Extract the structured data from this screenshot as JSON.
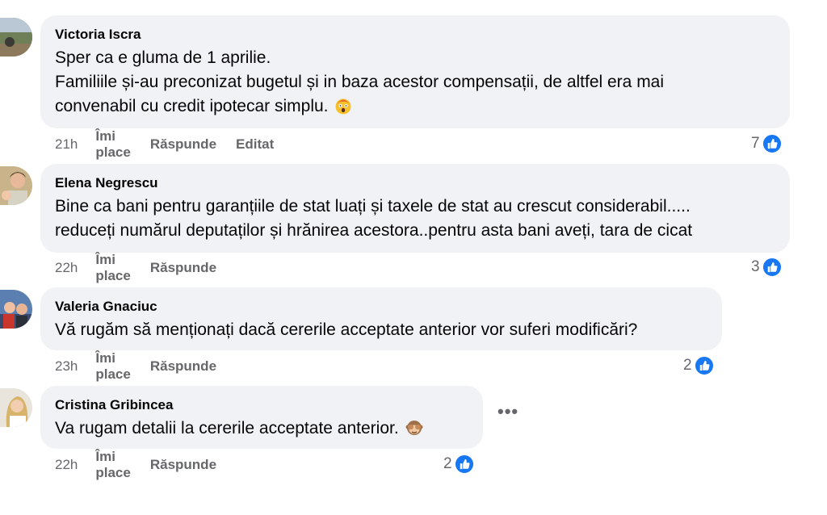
{
  "comments": [
    {
      "author": "Victoria Iscra",
      "lines": [
        "Sper ca e gluma de 1 aprilie.",
        "Familiile și-au preconizat bugetul și in baza acestor compensații, de altfel era mai",
        "convenabil cu credit ipotecar simplu."
      ],
      "emoji": "shocked-face-emoji",
      "time": "21h",
      "like_label": "Îmi place",
      "reply_label": "Răspunde",
      "edited_label": "Editat",
      "reactions_count": "7"
    },
    {
      "author": "Elena Negrescu",
      "lines": [
        "Bine ca bani pentru garanțiile de stat luați și taxele de stat au crescut considerabil.....",
        "reduceți numărul deputaților și hrănirea acestora..pentru asta bani aveți, tara de cicat"
      ],
      "time": "22h",
      "like_label": "Îmi place",
      "reply_label": "Răspunde",
      "reactions_count": "3"
    },
    {
      "author": "Valeria Gnaciuc",
      "lines": [
        "Vă rugăm să menționați dacă cererile acceptate anterior vor suferi modificări?"
      ],
      "time": "23h",
      "like_label": "Îmi place",
      "reply_label": "Răspunde",
      "reactions_count": "2"
    },
    {
      "author": "Cristina Gribincea",
      "lines": [
        "Va rugam detalii la cererile acceptate anterior."
      ],
      "emoji": "see-no-evil-monkey-emoji",
      "time": "22h",
      "like_label": "Îmi place",
      "reply_label": "Răspunde",
      "reactions_count": "2"
    }
  ],
  "more_options_label": "•••",
  "colors": {
    "bubble_bg": "#f0f2f5",
    "meta_text": "#65676b",
    "like_blue": "#1877f2"
  }
}
